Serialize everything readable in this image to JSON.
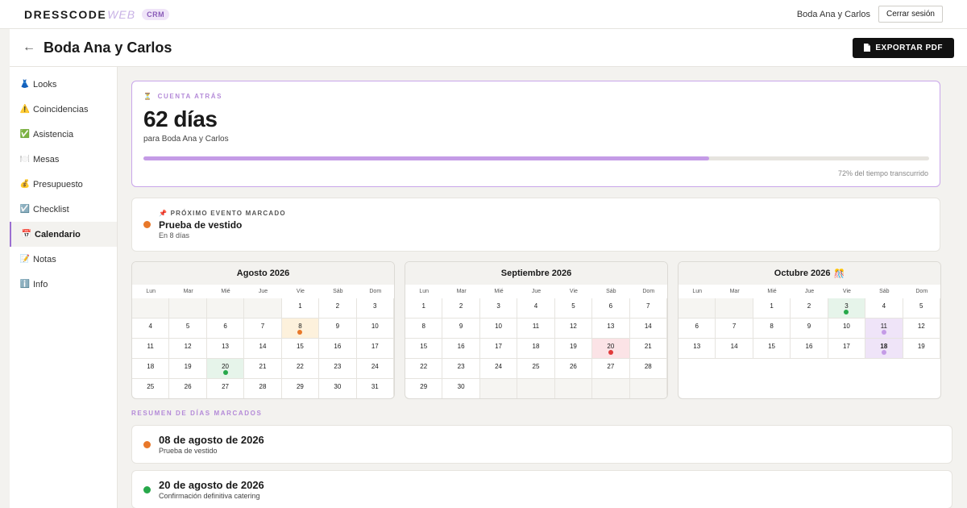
{
  "header": {
    "logo_main": "DRESSCODE",
    "logo_accent": "WEB",
    "badge": "CRM",
    "client_name": "Boda Ana y Carlos",
    "logout_label": "Cerrar sesión"
  },
  "titlebar": {
    "back": "←",
    "title": "Boda Ana y Carlos",
    "export_label": "EXPORTAR PDF"
  },
  "sidebar": {
    "items": [
      {
        "icon": "👗",
        "label": "Looks"
      },
      {
        "icon": "⚠️",
        "label": "Coincidencias"
      },
      {
        "icon": "✅",
        "label": "Asistencia"
      },
      {
        "icon": "🍽️",
        "label": "Mesas"
      },
      {
        "icon": "💰",
        "label": "Presupuesto"
      },
      {
        "icon": "☑️",
        "label": "Checklist"
      },
      {
        "icon": "📅",
        "label": "Calendario"
      },
      {
        "icon": "📝",
        "label": "Notas"
      },
      {
        "icon": "ℹ️",
        "label": "Info"
      }
    ],
    "active": "Calendario"
  },
  "countdown": {
    "icon": "⏳",
    "label": "CUENTA ATRÁS",
    "days": "62 días",
    "subtitle": "para Boda Ana y Carlos",
    "progress": 0.72,
    "percent_text": "72% del tiempo transcurrido"
  },
  "next_event": {
    "icon": "📌",
    "label": "PRÓXIMO EVENTO MARCADO",
    "title": "Prueba de vestido",
    "subtitle": "En 8 días",
    "color": "#e8782a"
  },
  "calendar": {
    "weekdays": [
      "Lun",
      "Mar",
      "Mié",
      "Jue",
      "Vie",
      "Sáb",
      "Dom"
    ],
    "months": [
      {
        "title": "Agosto 2026",
        "suffix": "",
        "offset": 4,
        "days": 31,
        "marks": [
          {
            "day": 8,
            "bg": "#fdf1dc",
            "dot": "#e8782a"
          },
          {
            "day": 20,
            "bg": "#e6f4ea",
            "dot": "#27a84a"
          }
        ]
      },
      {
        "title": "Septiembre 2026",
        "suffix": "",
        "offset": 0,
        "days": 30,
        "marks": [
          {
            "day": 20,
            "bg": "#fbe3e6",
            "dot": "#e03a3a"
          }
        ]
      },
      {
        "title": "Octubre 2026",
        "suffix": "🎊",
        "offset": 2,
        "days": 19,
        "marks": [
          {
            "day": 3,
            "bg": "#e6f4ea",
            "dot": "#27a84a"
          },
          {
            "day": 11,
            "bg": "#efe4f8",
            "dot": "#c49be6"
          },
          {
            "day": 18,
            "bg": "#efe4f8",
            "dot": "#c49be6",
            "bold": true
          }
        ]
      }
    ]
  },
  "summary": {
    "label": "RESUMEN DE DÍAS MARCADOS",
    "items": [
      {
        "date": "08 de agosto de 2026",
        "desc": "Prueba de vestido",
        "color": "#e8782a"
      },
      {
        "date": "20 de agosto de 2026",
        "desc": "Confirmación definitiva catering",
        "color": "#27a84a"
      }
    ]
  }
}
